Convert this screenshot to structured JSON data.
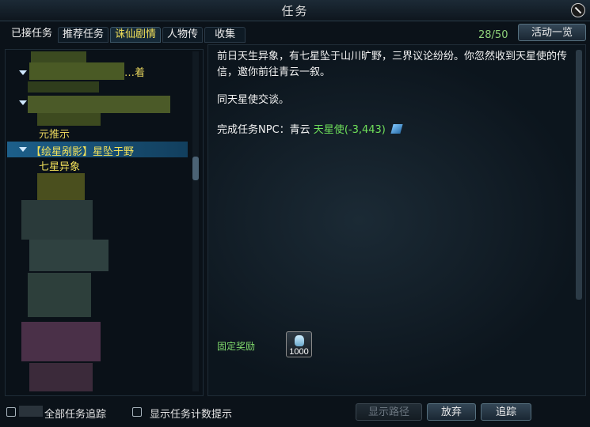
{
  "window": {
    "title": "任务"
  },
  "tabs": [
    {
      "label": "已接任务",
      "active": false
    },
    {
      "label": "推荐任务",
      "active": false
    },
    {
      "label": "诛仙剧情",
      "active": true
    },
    {
      "label": "人物传",
      "active": false
    },
    {
      "label": "收集",
      "active": false
    }
  ],
  "quest_count": "28/50",
  "activity_button": "活动一览",
  "tree": {
    "partial_top": "…着",
    "partial_mid": "元推示",
    "selected_chapter": "【绘星剐影】星坠于野",
    "selected_quest": "七星异象"
  },
  "detail": {
    "paragraph1": "前日天生异象，有七星坠于山川旷野，三界议论纷纷。你忽然收到天星使的传信，邀你前往青云一叙。",
    "paragraph2": "同天星使交谈。",
    "npc_label": "完成任务NPC：青云",
    "npc_name": "天星使",
    "npc_coord": "(-3,443)",
    "reward_label": "固定奖励",
    "reward_amount": "1000"
  },
  "footer": {
    "track_all": "全部任务追踪",
    "show_counter": "显示任务计数提示",
    "show_path": "显示路径",
    "abandon": "放弃",
    "track": "追踪"
  },
  "colors": {
    "accent_yellow": "#f2e15a",
    "green_text": "#6fe05a",
    "selected_row": "#1d5f8a"
  }
}
